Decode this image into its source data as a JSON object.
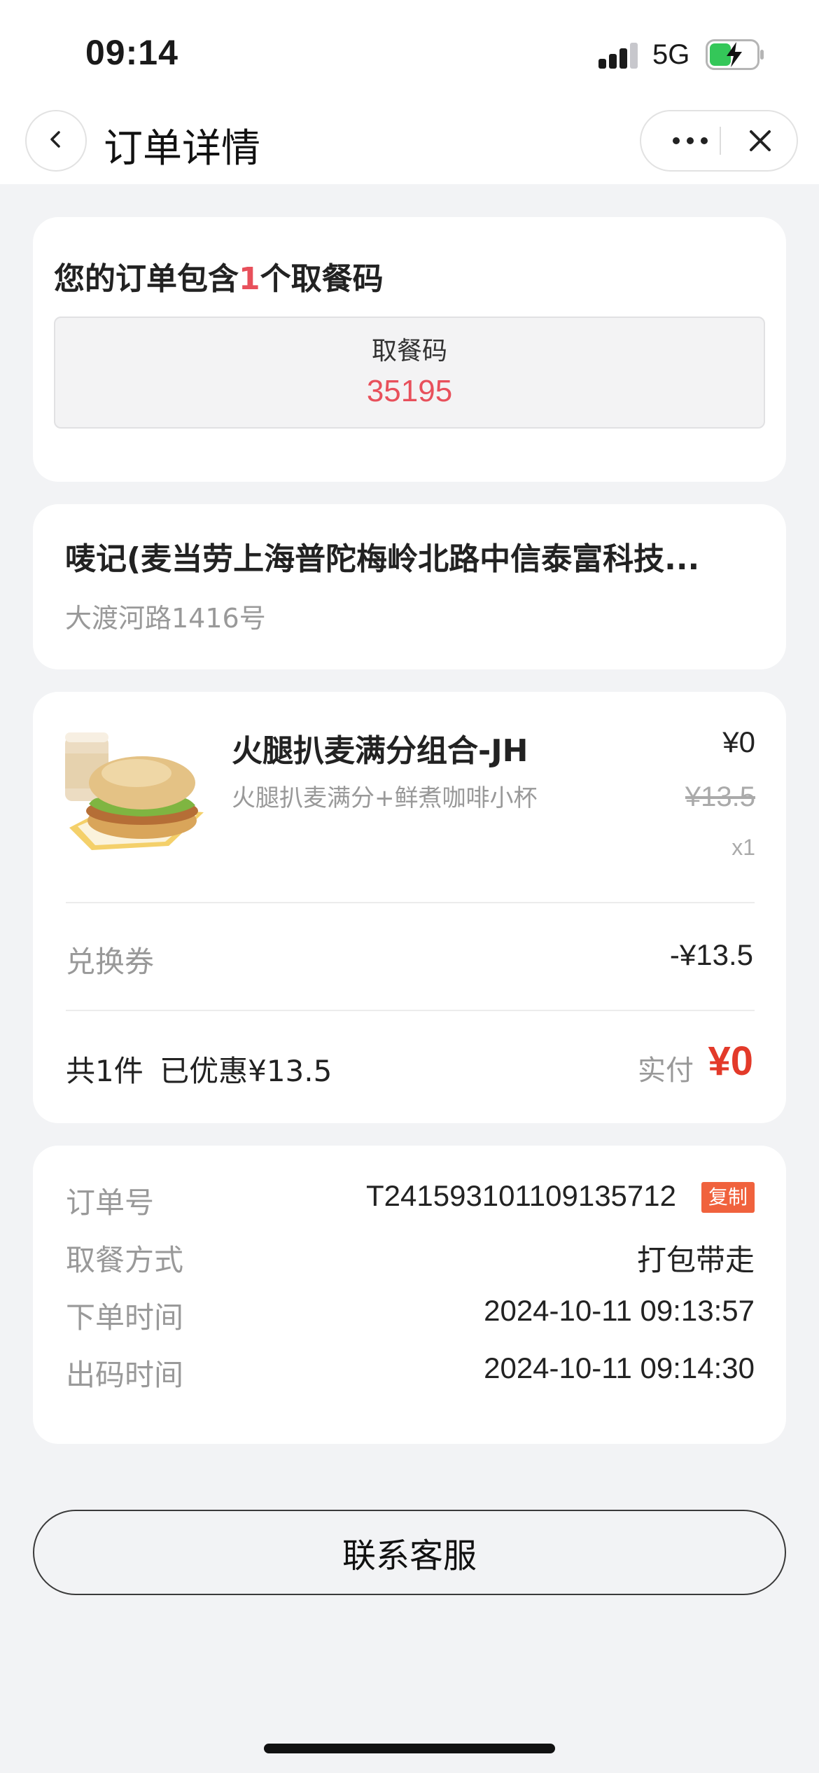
{
  "status_bar": {
    "time": "09:14",
    "network": "5G",
    "battery_color": "#34c759"
  },
  "nav": {
    "title": "订单详情",
    "back_icon": "chevron-left-icon",
    "more_icon": "more-dots-icon",
    "close_icon": "close-icon"
  },
  "pickup": {
    "heading_prefix": "您的订单包含",
    "heading_count": "1",
    "heading_suffix": "个取餐码",
    "code_label": "取餐码",
    "code_value": "35195",
    "accent_color": "#e8505b"
  },
  "store": {
    "name": "唛记(麦当劳上海普陀梅岭北路中信泰富科技...",
    "address": "大渡河路1416号"
  },
  "items": [
    {
      "name": "火腿扒麦满分组合-JH",
      "description": "火腿扒麦满分+鲜煮咖啡小杯",
      "price": "¥0",
      "original_price": "¥13.5",
      "quantity": "x1"
    }
  ],
  "discounts": {
    "coupon_label": "兑换券",
    "coupon_value": "-¥13.5"
  },
  "summary": {
    "count_text": "共1件",
    "saved_text": "已优惠¥13.5",
    "paid_label": "实付",
    "paid_value": "¥0",
    "paid_color": "#e33a2a"
  },
  "order_info": {
    "order_no_label": "订单号",
    "order_no_value": "T241593101109135712",
    "copy_label": "复制",
    "pickup_method_label": "取餐方式",
    "pickup_method_value": "打包带走",
    "order_time_label": "下单时间",
    "order_time_value": "2024-10-11 09:13:57",
    "code_time_label": "出码时间",
    "code_time_value": "2024-10-11 09:14:30"
  },
  "contact": {
    "label": "联系客服"
  }
}
